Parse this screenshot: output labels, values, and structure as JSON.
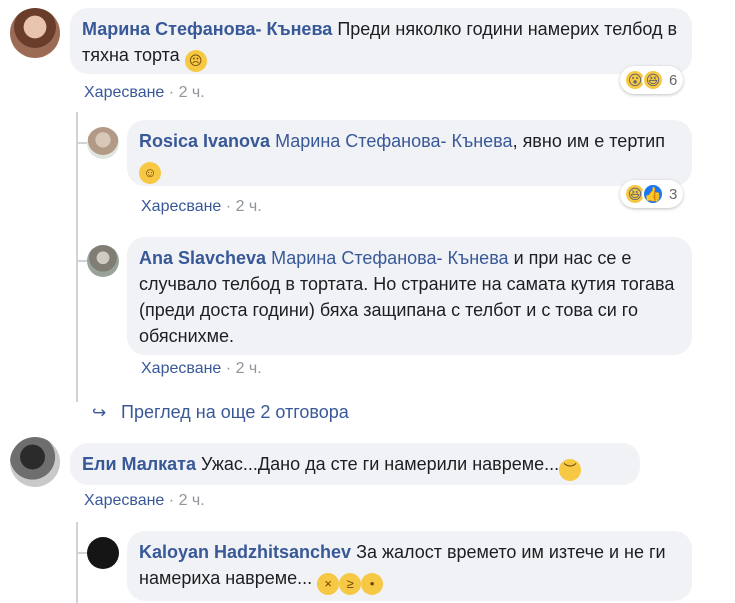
{
  "comments": [
    {
      "author": "Марина Стефанова- Кънева",
      "text": "Преди няколко години намерих телбод в тяхна торта",
      "emoji": "😟",
      "like_label": "Харесване",
      "dot": "·",
      "time": "2 ч.",
      "reactions": {
        "icons": [
          "wow-icon",
          "haha-icon"
        ],
        "count": "6"
      }
    },
    {
      "author": "Rosica Ivanova",
      "mention": "Марина Стефанова- Кънева",
      "text": ", явно им е тертип",
      "emoji": "😃",
      "like_label": "Харесване",
      "dot": "·",
      "time": "2 ч.",
      "reactions": {
        "icons": [
          "haha-icon",
          "like-icon"
        ],
        "count": "3"
      }
    },
    {
      "author": "Ana Slavcheva",
      "mention": "Марина Стефанова- Кънева",
      "text": " и при нас се е случвало телбод в тортата. Но страните на самата кутия тогава (преди доста години) бяха защипана с телбот и с това си го обяснихме.",
      "like_label": "Харесване",
      "dot": "·",
      "time": "2 ч."
    },
    {
      "author": "Ели Малката",
      "text": "Ужас...Дано да сте ги намерили навреме...",
      "emoji": "😔",
      "like_label": "Харесване",
      "dot": "·",
      "time": "2 ч."
    },
    {
      "author": "Kaloyan Hadzhitsanchev",
      "text": "За жалост времето им изтече и не ги намериха навреме...",
      "emojis": [
        "😩",
        "😫",
        "😢"
      ]
    }
  ],
  "more_replies": "Преглед на още 2 отговора",
  "colors": {
    "link": "#385898",
    "bubble": "#f0f2f5",
    "meta": "#90949c"
  }
}
